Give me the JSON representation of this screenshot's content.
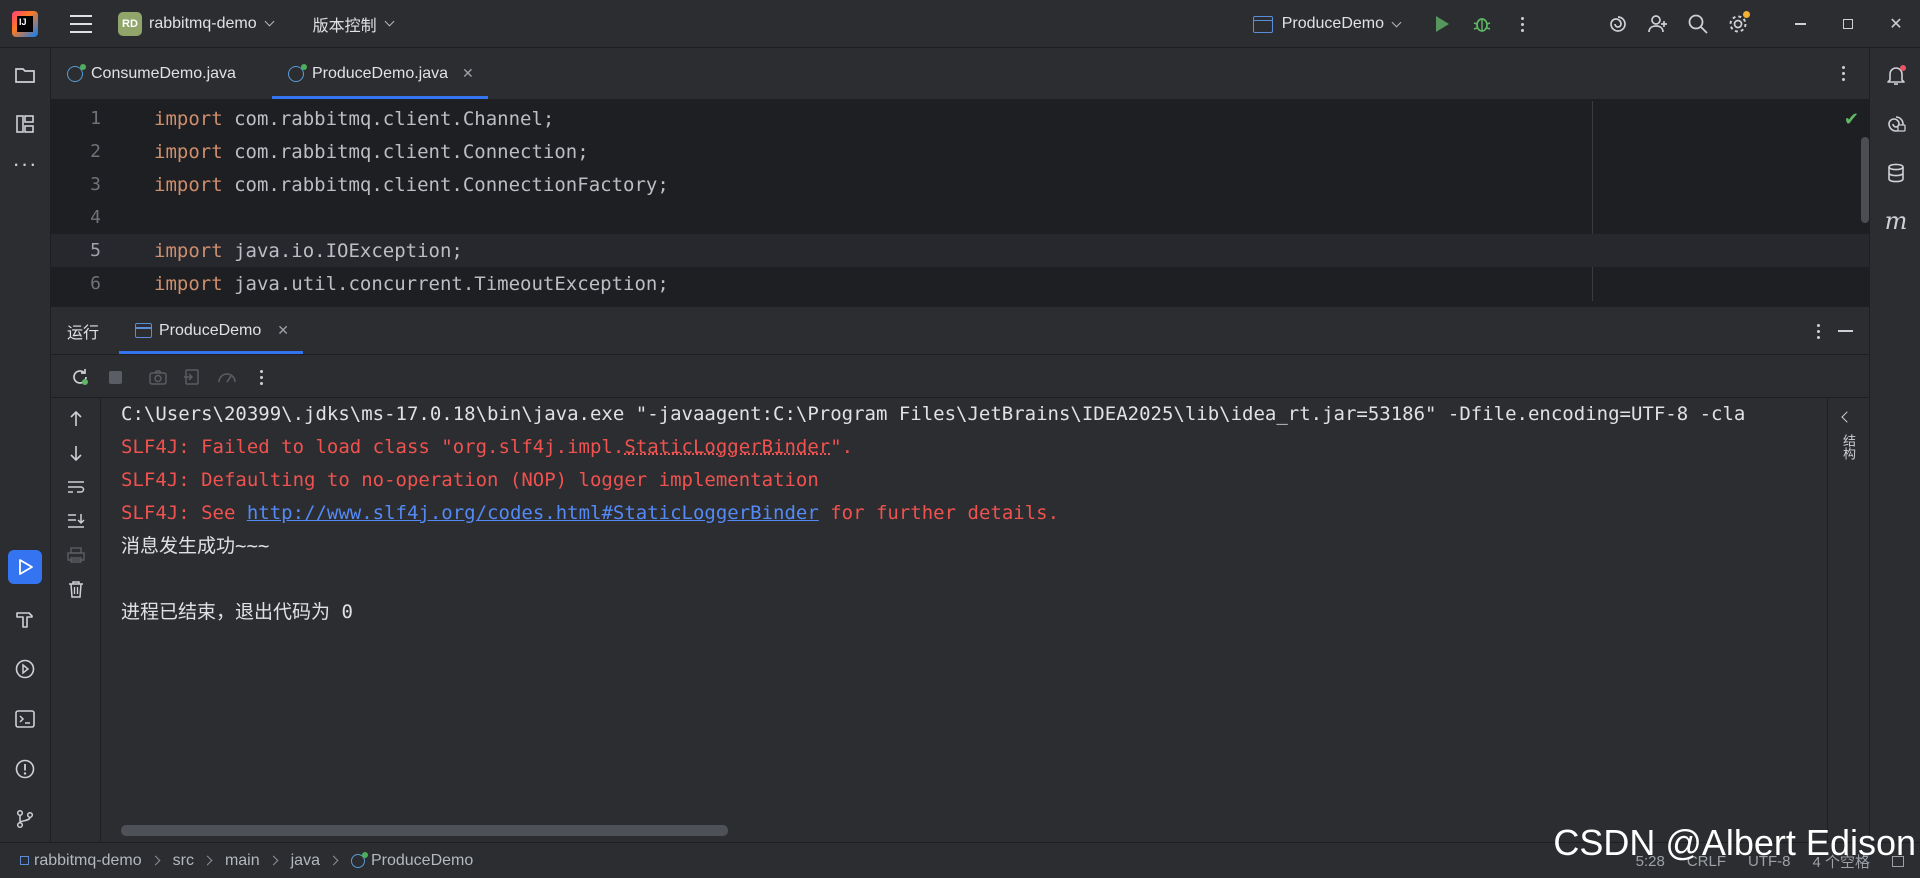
{
  "titlebar": {
    "project_badge": "RD",
    "project_name": "rabbitmq-demo",
    "vcs_label": "版本控制",
    "run_config": "ProduceDemo"
  },
  "editor_tabs": [
    {
      "label": "ConsumeDemo.java",
      "active": false
    },
    {
      "label": "ProduceDemo.java",
      "active": true
    }
  ],
  "code": {
    "lines": [
      {
        "num": "1",
        "kw": "import",
        "text": " com.rabbitmq.client.Channel;"
      },
      {
        "num": "2",
        "kw": "import",
        "text": " com.rabbitmq.client.Connection;"
      },
      {
        "num": "3",
        "kw": "import",
        "text": " com.rabbitmq.client.ConnectionFactory;"
      },
      {
        "num": "4",
        "kw": "",
        "text": ""
      },
      {
        "num": "5",
        "kw": "import",
        "text": " java.io.IOException;"
      },
      {
        "num": "6",
        "kw": "import",
        "text": " java.util.concurrent.TimeoutException;"
      }
    ],
    "current_line": "5"
  },
  "run_window": {
    "title": "运行",
    "tab_label": "ProduceDemo",
    "side_label": "结构"
  },
  "console": {
    "cmd": "C:\\Users\\20399\\.jdks\\ms-17.0.18\\bin\\java.exe \"-javaagent:C:\\Program Files\\JetBrains\\IDEA2025\\lib\\idea_rt.jar=53186\" -Dfile.encoding=UTF-8 -cla",
    "err1_prefix": "SLF4J: Failed to load class \"org.slf4j.impl.",
    "err1_class": "StaticLoggerBinder",
    "err1_suffix": "\".",
    "err2": "SLF4J: Defaulting to no-operation (NOP) logger implementation",
    "err3_prefix": "SLF4J: See ",
    "err3_link": "http://www.slf4j.org/codes.html#StaticLoggerBinder",
    "err3_suffix": " for further details.",
    "out1": "消息发生成功~~~",
    "exit": "进程已结束，退出代码为 0"
  },
  "statusbar": {
    "crumbs": [
      "rabbitmq-demo",
      "src",
      "main",
      "java",
      "ProduceDemo"
    ],
    "position": "5:28",
    "line_sep": "CRLF",
    "encoding": "UTF-8",
    "indent": "4 个空格"
  },
  "watermark": "CSDN @Albert Edison",
  "colors": {
    "accent": "#3574f0",
    "keyword": "#cf8e6d",
    "error": "#f0524f",
    "link": "#548af7",
    "run_green": "#5fb865"
  }
}
